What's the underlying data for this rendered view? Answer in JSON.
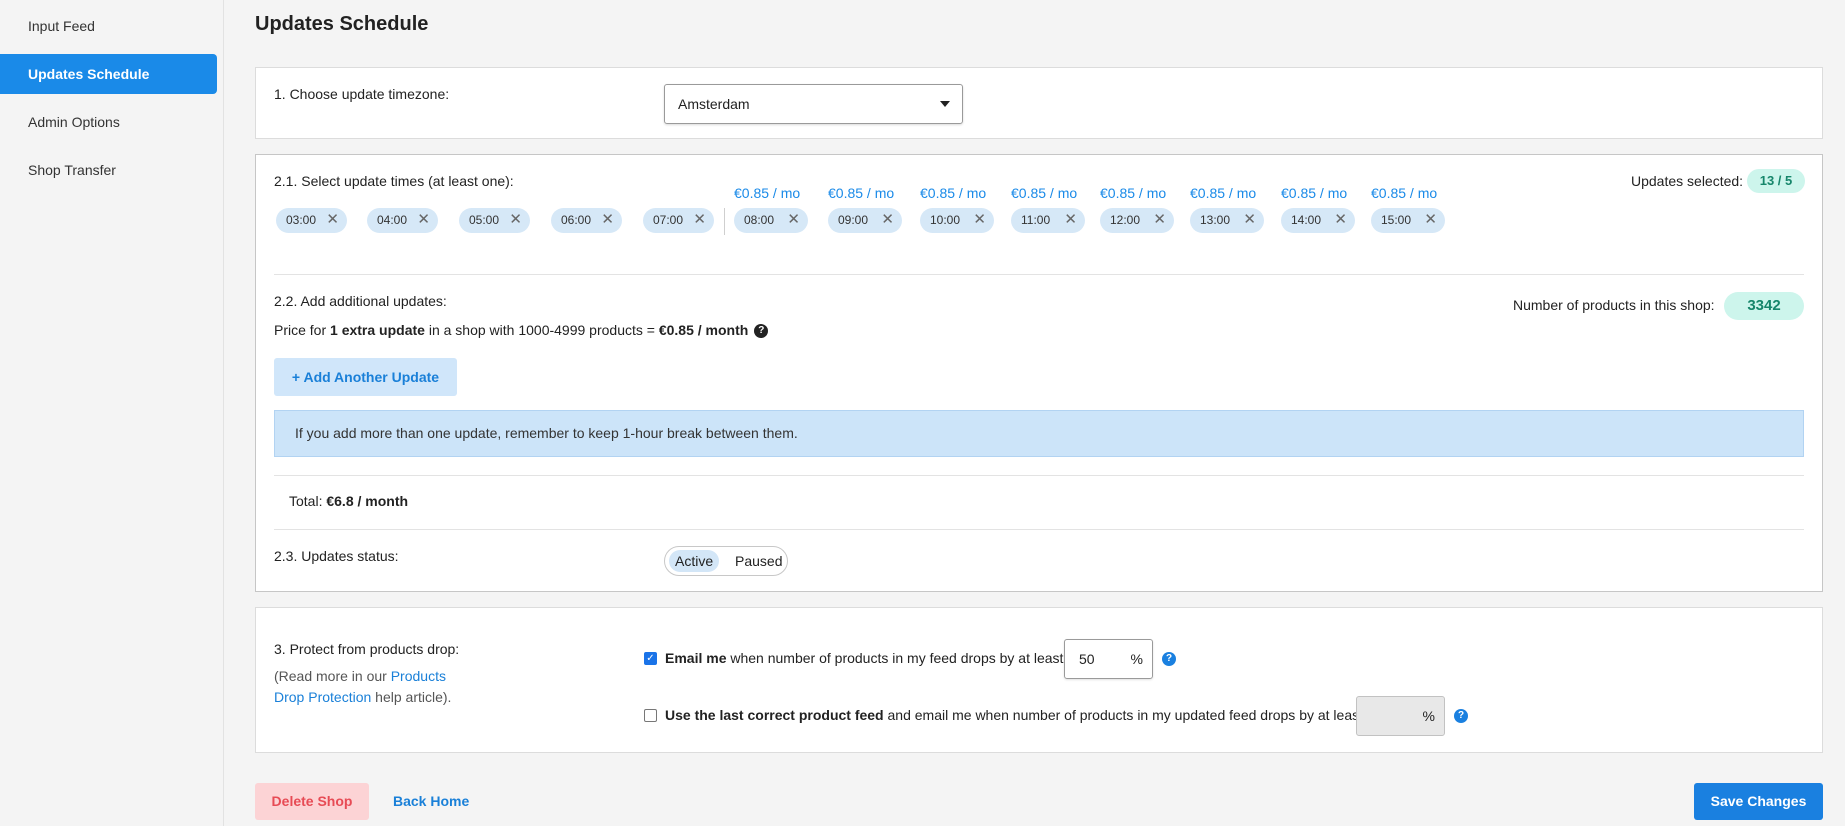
{
  "sidebar": {
    "items": [
      {
        "label": "Input Feed",
        "active": false
      },
      {
        "label": "Updates Schedule",
        "active": true
      },
      {
        "label": "Admin Options",
        "active": false
      },
      {
        "label": "Shop Transfer",
        "active": false
      }
    ]
  },
  "page_title": "Updates Schedule",
  "timezone": {
    "label": "1. Choose update timezone:",
    "value": "Amsterdam"
  },
  "update_times": {
    "label": "2.1. Select update times (at least one):",
    "selected_label": "Updates selected:",
    "selected_value": "13 / 5",
    "free": [
      "03:00",
      "04:00",
      "05:00",
      "06:00",
      "07:00"
    ],
    "paid": [
      "08:00",
      "09:00",
      "10:00",
      "11:00",
      "12:00",
      "13:00",
      "14:00",
      "15:00"
    ],
    "paid_price": "€0.85 / mo"
  },
  "additional": {
    "label": "2.2. Add additional updates:",
    "price_prefix": "Price for ",
    "price_bold": "1 extra update",
    "price_mid": " in a shop with 1000-4999 products = ",
    "price_value": "€0.85 / month",
    "help_glyph": "?",
    "products_label": "Number of products in this shop:",
    "products_count": "3342",
    "add_button": "+ Add Another Update",
    "info": "If you add more than one update, remember to keep 1-hour break between them."
  },
  "total": {
    "label": "Total: ",
    "value": "€6.8 / month"
  },
  "status": {
    "label": "2.3. Updates status:",
    "active": "Active",
    "paused": "Paused",
    "current": "Active"
  },
  "protect": {
    "label": "3. Protect from products drop:",
    "read_prefix": "(Read more in our ",
    "read_link1": "Products",
    "read_link2": "Drop Protection",
    "read_suffix": " help article).",
    "email_bold": "Email me",
    "email_text": " when number of products in my feed drops by at least",
    "email_value": "50",
    "email_checked": true,
    "lastfeed_bold": "Use the last correct product feed",
    "lastfeed_text": " and email me when number of products in my updated feed drops by at least",
    "lastfeed_value": "",
    "lastfeed_checked": false,
    "percent": "%",
    "help_glyph": "?"
  },
  "footer": {
    "delete": "Delete Shop",
    "back": "Back Home",
    "save": "Save Changes"
  },
  "colors": {
    "accent": "#1a8ae8",
    "badge_bg": "#cdf5ec",
    "badge_text": "#16866b",
    "danger": "#e74b55"
  }
}
